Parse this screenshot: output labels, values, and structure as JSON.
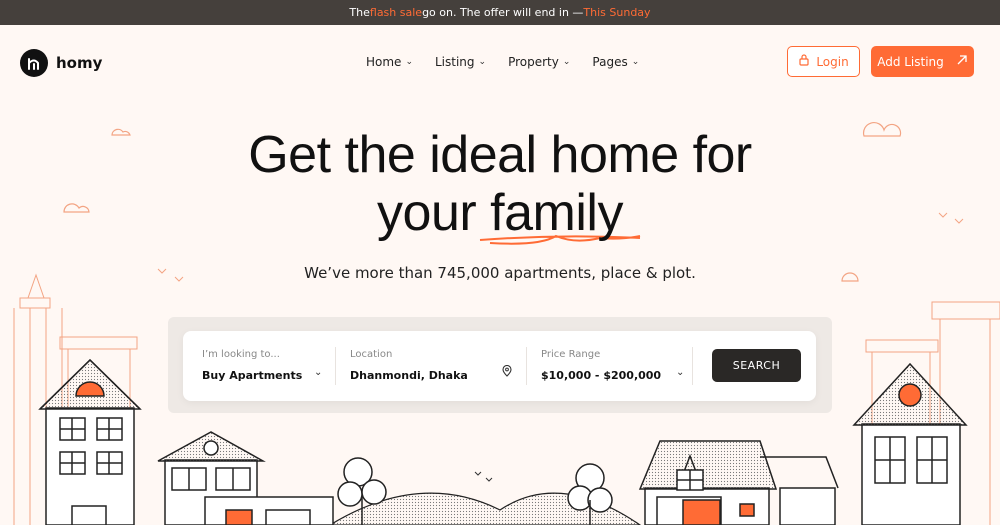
{
  "topbar": {
    "pre": "The ",
    "highlight": "flash sale",
    "mid": " go on. The offer will end in — ",
    "deadline": "This Sunday"
  },
  "brand": {
    "name": "homy",
    "accent": "#ff6b35"
  },
  "nav": {
    "items": [
      {
        "label": "Home"
      },
      {
        "label": "Listing"
      },
      {
        "label": "Property"
      },
      {
        "label": "Pages"
      }
    ]
  },
  "actions": {
    "login": "Login",
    "add_listing": "Add Listing"
  },
  "hero": {
    "line1": "Get the ideal home for",
    "line2_pre": "your ",
    "line2_word": "family",
    "subtitle": "We’ve more than 745,000 apartments, place & plot."
  },
  "search": {
    "looking_label": "I’m looking to...",
    "looking_value": "Buy Apartments",
    "location_label": "Location",
    "location_value": "Dhanmondi, Dhaka",
    "price_label": "Price Range",
    "price_value": "$10,000 - $200,000",
    "button": "SEARCH"
  },
  "icons": [
    "logo-icon",
    "chevron-down-icon",
    "login-icon",
    "arrow-up-right-icon",
    "location-pin-icon"
  ]
}
